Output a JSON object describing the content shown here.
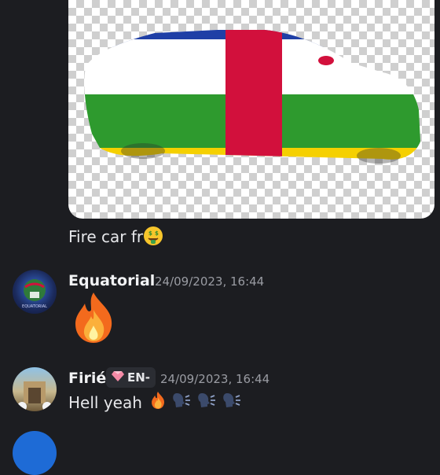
{
  "messages": [
    {
      "caption": "Fire car fr",
      "caption_emoji": "money-mouth-face-icon"
    },
    {
      "username": "Equatorial",
      "timestamp": "24/09/2023, 16:44",
      "avatar_text": "EQUATORIAL",
      "content_emoji": "fire-icon"
    },
    {
      "username": "Firié",
      "timestamp": "24/09/2023, 16:44",
      "tag_label": "EN-",
      "tag_icon": "gem-icon",
      "text": "Hell yeah",
      "trailing_emojis": [
        "fire-icon",
        "speaking-head-icon",
        "speaking-head-icon",
        "speaking-head-icon"
      ]
    }
  ],
  "colors": {
    "background": "#1c1d21",
    "username": "#f2f3f5",
    "timestamp": "#9a9ca3",
    "flag_blue": "#1f3fa6",
    "flag_white": "#ffffff",
    "flag_green": "#2e9a2e",
    "flag_yellow": "#f5d000",
    "flag_red": "#d2103c"
  }
}
